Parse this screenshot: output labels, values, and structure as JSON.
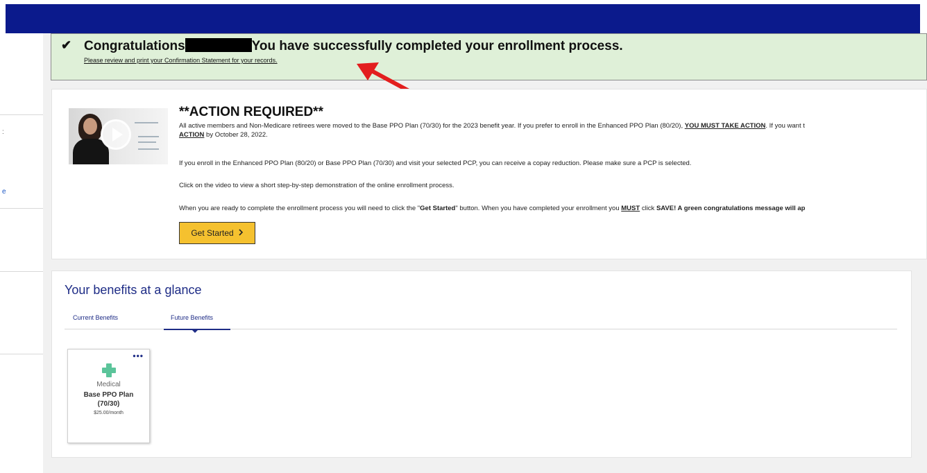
{
  "header": {
    "bar_color": "#0b1a8c"
  },
  "sidebar": {
    "fragments": [
      ":",
      "e"
    ]
  },
  "banner": {
    "check_icon": "checkmark-icon",
    "congrats_word": "Congratulations",
    "message": "You have successfully completed your enrollment process.",
    "link_text": "Please review and print your Confirmation Statement for your records.",
    "background": "#dff0d8"
  },
  "action": {
    "title": "**ACTION REQUIRED**",
    "p1_a": "All active members and Non-Medicare retirees were moved to the Base PPO Plan (70/30) for the 2023 benefit year. If you prefer to enroll in the Enhanced PPO Plan (80/20), ",
    "p1_b": "YOU MUST TAKE ACTION",
    "p1_c": ". If you want t",
    "p1_d": "ACTION",
    "p1_e": " by October 28, 2022.",
    "p2": "If you enroll in the Enhanced PPO Plan (80/20) or Base PPO Plan (70/30) and visit your selected PCP, you can receive a copay reduction. Please make sure a PCP is selected.",
    "p3": "Click on the video to view a short step-by-step demonstration of the online enrollment process.",
    "p4_a": "When you are ready to complete the enrollment process you will need to click the \"",
    "p4_b": "Get Started",
    "p4_c": "\" button. When you have completed your enrollment you ",
    "p4_d": "MUST",
    "p4_e": " click ",
    "p4_f": "SAVE! A green congratulations message will ap",
    "button_label": "Get Started",
    "button_icon": "chevron-right-icon",
    "button_color": "#f5c12f"
  },
  "benefits": {
    "title": "Your benefits at a glance",
    "tabs": [
      {
        "label": "Current Benefits"
      },
      {
        "label": "Future Benefits"
      }
    ],
    "tile": {
      "icon": "medical-cross-icon",
      "menu_icon": "more-dots-icon",
      "category": "Medical",
      "plan_line1": "Base PPO Plan",
      "plan_line2": "(70/30)",
      "price": "$25.00/month"
    }
  }
}
